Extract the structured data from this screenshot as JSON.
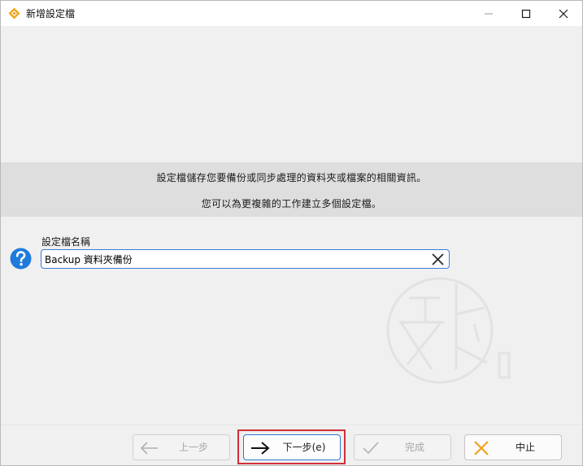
{
  "window": {
    "title": "新增設定檔"
  },
  "banner": {
    "line1": "設定檔儲存您要備份或同步處理的資料夾或檔案的相關資訊。",
    "line2": "您可以為更複雜的工作建立多個設定檔。"
  },
  "form": {
    "name_label": "設定檔名稱",
    "name_value": "Backup 資料夾備份"
  },
  "buttons": {
    "back_label": "上一步",
    "next_label": "下一步(e)",
    "finish_label": "完成",
    "cancel_label": "中止"
  },
  "colors": {
    "accent": "#2f76d2",
    "focus_highlight": "#d0303a",
    "app_icon_orange": "#f0a818",
    "help_icon_blue": "#1f7bdb"
  },
  "icons": {
    "app": "app-logo-icon",
    "minimize": "minimize-icon",
    "maximize": "maximize-icon",
    "close": "close-icon",
    "help": "question-mark-icon",
    "clear": "clear-x-icon",
    "back": "arrow-left-icon",
    "next": "arrow-right-icon",
    "finish": "checkmark-icon",
    "cancel": "cross-icon"
  }
}
